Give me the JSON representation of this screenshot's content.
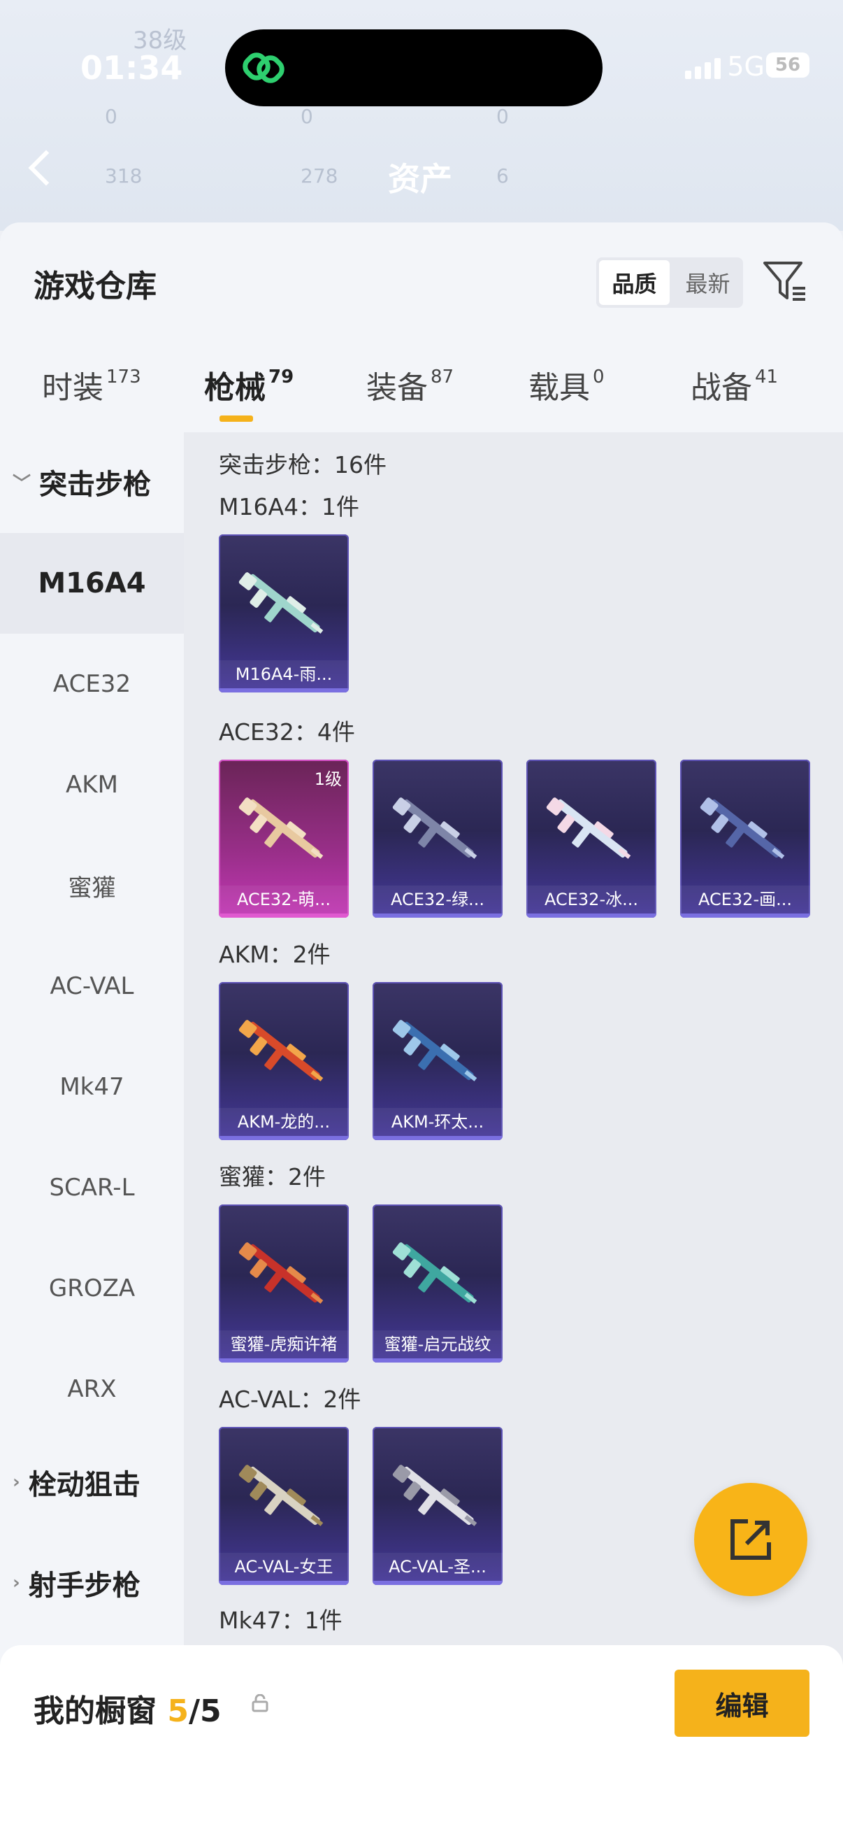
{
  "status_bar": {
    "time": "01:34",
    "network": "5G",
    "battery": "56"
  },
  "header": {
    "title": "资产",
    "background_text": [
      "38级",
      "0",
      "0",
      "0",
      "318",
      "278",
      "6"
    ]
  },
  "sheet": {
    "title": "游戏仓库",
    "sort_options": [
      "品质",
      "最新"
    ]
  },
  "tabs": [
    {
      "label": "时装",
      "count": "173"
    },
    {
      "label": "枪械",
      "count": "79"
    },
    {
      "label": "装备",
      "count": "87"
    },
    {
      "label": "载具",
      "count": "0"
    },
    {
      "label": "战备",
      "count": "41"
    }
  ],
  "sidebar": {
    "group_open": "突击步枪",
    "items": [
      "M16A4",
      "ACE32",
      "AKM",
      "蜜獾",
      "AC-VAL",
      "Mk47",
      "SCAR-L",
      "GROZA",
      "ARX"
    ],
    "groups_closed": [
      "栓动狙击",
      "射手步枪"
    ]
  },
  "main": {
    "summary": "突击步枪：16件",
    "sections": [
      {
        "title": "M16A4：1件",
        "cards": [
          {
            "name": "M16A4-雨..."
          }
        ]
      },
      {
        "title": "ACE32：4件",
        "cards": [
          {
            "name": "ACE32-萌...",
            "level": "1级"
          },
          {
            "name": "ACE32-绿..."
          },
          {
            "name": "ACE32-冰..."
          },
          {
            "name": "ACE32-画..."
          }
        ]
      },
      {
        "title": "AKM：2件",
        "cards": [
          {
            "name": "AKM-龙的..."
          },
          {
            "name": "AKM-环太..."
          }
        ]
      },
      {
        "title": "蜜獾：2件",
        "cards": [
          {
            "name": "蜜獾-虎痴许褚"
          },
          {
            "name": "蜜獾-启元战纹"
          }
        ]
      },
      {
        "title": "AC-VAL：2件",
        "cards": [
          {
            "name": "AC-VAL-女王"
          },
          {
            "name": "AC-VAL-圣..."
          }
        ]
      },
      {
        "title": "Mk47：1件",
        "cards": []
      }
    ]
  },
  "bottom": {
    "label": "我的橱窗",
    "current": "5",
    "total": "/5",
    "edit": "编辑"
  },
  "colors": {
    "accent": "#f5b21b",
    "card": "#2b2754",
    "card_pink": "#c238b5"
  }
}
